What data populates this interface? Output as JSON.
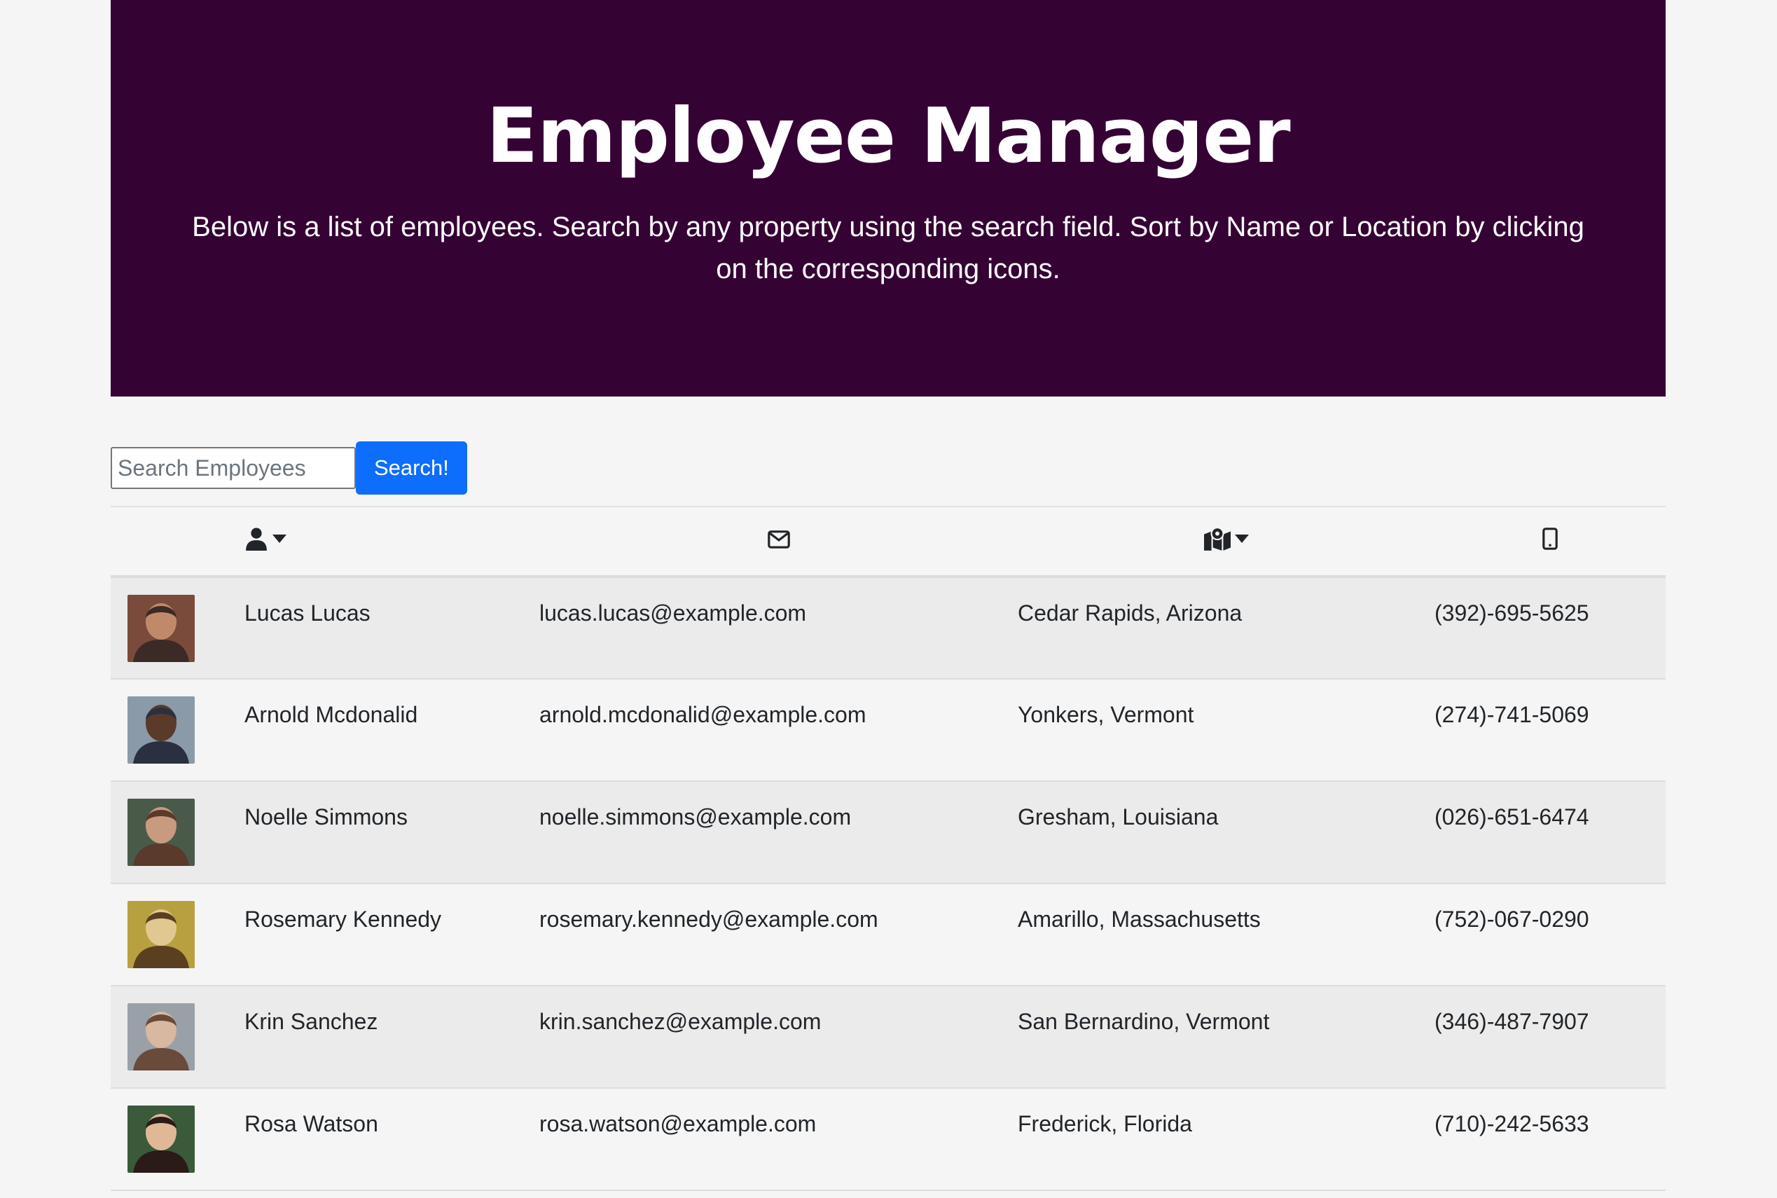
{
  "header": {
    "title": "Employee Manager",
    "description": "Below is a list of employees. Search by any property using the search field. Sort by Name or Location by clicking on the corresponding icons."
  },
  "search": {
    "placeholder": "Search Employees",
    "value": "",
    "button_label": "Search!"
  },
  "table": {
    "columns": [
      {
        "id": "image",
        "icon": ""
      },
      {
        "id": "name",
        "icon": "user-icon",
        "sortable": true
      },
      {
        "id": "email",
        "icon": "envelope-icon",
        "sortable": false
      },
      {
        "id": "location",
        "icon": "map-location-icon",
        "sortable": true
      },
      {
        "id": "phone",
        "icon": "mobile-phone-icon",
        "sortable": false
      }
    ],
    "rows": [
      {
        "name": "Lucas Lucas",
        "email": "lucas.lucas@example.com",
        "location": "Cedar Rapids, Arizona",
        "phone": "(392)-695-5625",
        "avatar_colors": [
          "#7a4a3a",
          "#c08a6a",
          "#3b2a25"
        ]
      },
      {
        "name": "Arnold Mcdonalid",
        "email": "arnold.mcdonalid@example.com",
        "location": "Yonkers, Vermont",
        "phone": "(274)-741-5069",
        "avatar_colors": [
          "#8a9aa8",
          "#5a3a2a",
          "#2a3040"
        ]
      },
      {
        "name": "Noelle Simmons",
        "email": "noelle.simmons@example.com",
        "location": "Gresham, Louisiana",
        "phone": "(026)-651-6474",
        "avatar_colors": [
          "#4a5a4a",
          "#c89a80",
          "#5a3a2a"
        ]
      },
      {
        "name": "Rosemary Kennedy",
        "email": "rosemary.kennedy@example.com",
        "location": "Amarillo, Massachusetts",
        "phone": "(752)-067-0290",
        "avatar_colors": [
          "#b8a040",
          "#e0c890",
          "#5a4020"
        ]
      },
      {
        "name": "Krin Sanchez",
        "email": "krin.sanchez@example.com",
        "location": "San Bernardino, Vermont",
        "phone": "(346)-487-7907",
        "avatar_colors": [
          "#9aa0a8",
          "#d8b8a0",
          "#6a4a3a"
        ]
      },
      {
        "name": "Rosa Watson",
        "email": "rosa.watson@example.com",
        "location": "Frederick, Florida",
        "phone": "(710)-242-5633",
        "avatar_colors": [
          "#3a5a3a",
          "#e0b898",
          "#2a1a18"
        ]
      }
    ]
  },
  "colors": {
    "header_bg": "#350234",
    "button_bg": "#0d6efd",
    "page_bg": "#f5f5f5",
    "row_stripe": "#ebebeb"
  }
}
